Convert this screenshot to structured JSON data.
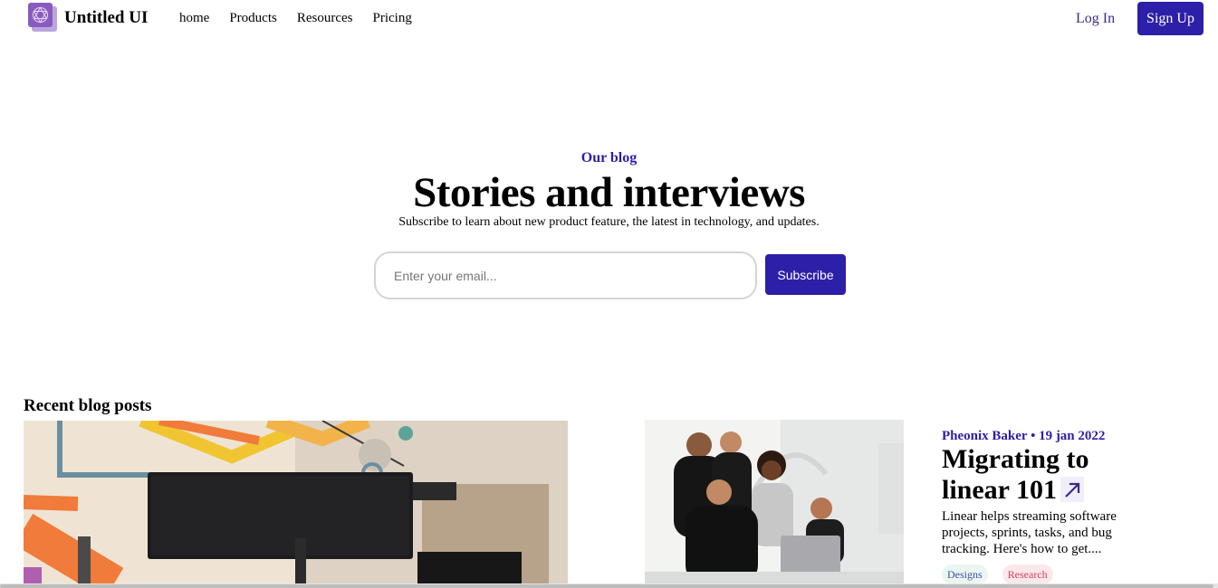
{
  "nav": {
    "brand": "Untitled UI",
    "links": [
      "home",
      "Products",
      "Resources",
      "Pricing"
    ],
    "login": "Log In",
    "signup": "Sign Up"
  },
  "hero": {
    "eyebrow": "Our blog",
    "title": "Stories and interviews",
    "subtitle": "Subscribe to learn about new product feature, the latest in technology, and updates.",
    "email_placeholder": "Enter your email...",
    "subscribe": "Subscribe"
  },
  "recent": {
    "heading": "Recent blog posts",
    "post": {
      "meta": "Pheonix Baker • 19 jan 2022",
      "title": "Migrating to linear 101",
      "excerpt": "Linear helps streaming software projects, sprints, tasks, and bug tracking. Here's how to get....",
      "tags": [
        "Designs",
        "Research"
      ]
    }
  },
  "colors": {
    "accent": "#2c1fa8",
    "tag_designs_bg": "#eaf7f0",
    "tag_research_bg": "#fde7ea"
  },
  "icons": {
    "logo": "cube-logo-icon",
    "post_link": "arrow-up-right-icon"
  }
}
